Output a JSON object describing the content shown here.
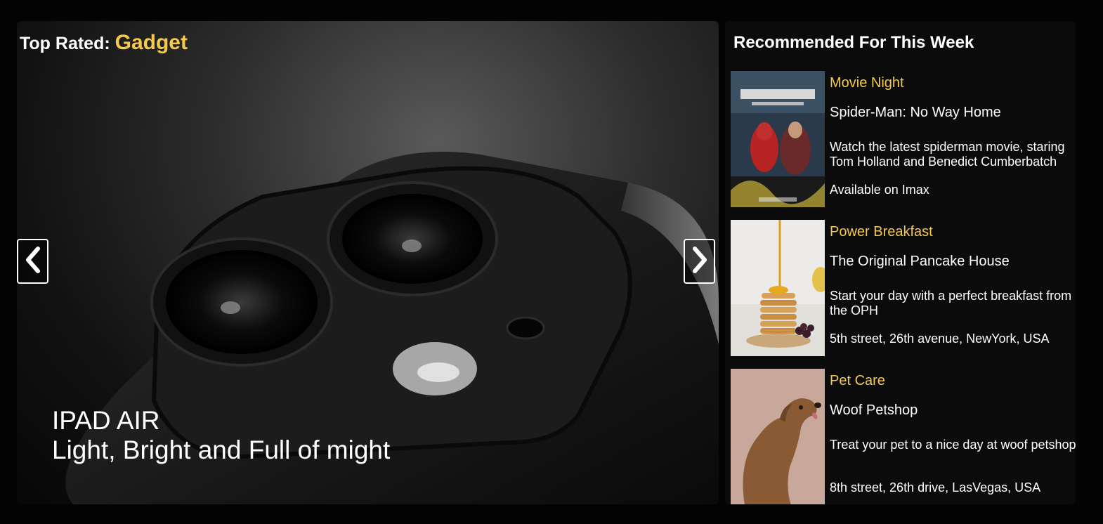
{
  "hero": {
    "heading_prefix": "Top Rated:",
    "heading_category": "Gadget",
    "caption_title": "IPAD AIR",
    "caption_subtitle": "Light, Bright and Full of might",
    "prev_icon": "chevron-left-icon",
    "next_icon": "chevron-right-icon"
  },
  "recommended": {
    "title": "Recommended For This Week",
    "items": [
      {
        "category": "Movie Night",
        "name": "Spider-Man: No Way Home",
        "description": "Watch the latest spiderman movie, staring Tom Holland and Benedict Cumberbatch",
        "location": "Available on Imax"
      },
      {
        "category": "Power Breakfast",
        "name": "The Original Pancake House",
        "description": "Start your day with a perfect breakfast from the OPH",
        "location": "5th street, 26th avenue, NewYork, USA"
      },
      {
        "category": "Pet Care",
        "name": "Woof Petshop",
        "description": "Treat your pet to a nice day at woof petshop",
        "location": "8th street, 26th drive, LasVegas, USA"
      }
    ]
  },
  "colors": {
    "accent": "#f5c94a",
    "background": "#030303",
    "panel": "#0b0b0b",
    "text": "#ffffff"
  }
}
